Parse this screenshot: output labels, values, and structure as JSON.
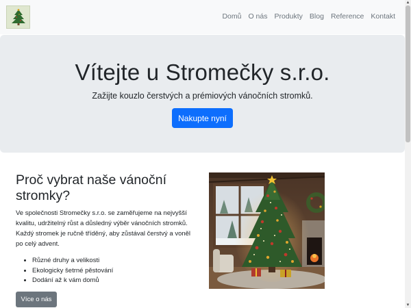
{
  "nav": {
    "logo_alt": "Stromečky logo",
    "links": [
      "Domů",
      "O nás",
      "Produkty",
      "Blog",
      "Reference",
      "Kontakt"
    ]
  },
  "hero": {
    "title": "Vítejte u Stromečky s.r.o.",
    "subtitle": "Zažijte kouzlo čerstvých a prémiových vánočních stromků.",
    "cta_label": "Nakupte nyní"
  },
  "why": {
    "title": "Proč vybrat naše vánoční stromky?",
    "text": "Ve společnosti Stromečky s.r.o. se zaměřujeme na nejvyšší kvalitu, udržitelný růst a důsledný výběr vánočních stromků. Každý stromek je ručně tříděný, aby zůstával čerstvý a voněl po celý advent.",
    "features": [
      "Různé druhy a velikosti",
      "Ekologicky šetrné pěstování",
      "Dodání až k vám domů"
    ],
    "more_label": "Více o nás"
  },
  "colors": {
    "primary": "#0d6efd",
    "secondary": "#6c757d",
    "hero_bg": "#e9ecef",
    "navbar_bg": "#f8f9fa"
  },
  "icons": {
    "logo": "christmas-tree-logo-icon",
    "image": "christmas-tree-room-image"
  }
}
